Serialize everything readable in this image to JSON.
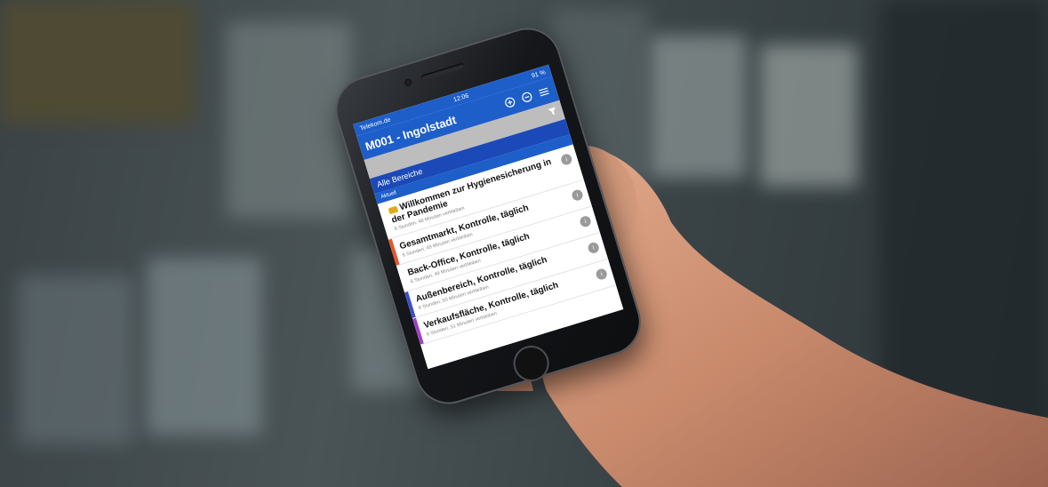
{
  "status_bar": {
    "carrier": "Telekom.de",
    "time": "12:06",
    "battery": "91 %"
  },
  "app_bar": {
    "title": "M001 - Ingolstadt"
  },
  "area_bar": {
    "label": "Alle Bereiche"
  },
  "section": {
    "label": "Aktuell"
  },
  "items": [
    {
      "title": "Willkommen zur Hygienesicherung in der Pandemie",
      "subtitle": "6 Stunden, 48 Minuten verbleiben",
      "badge": "i",
      "accent": ""
    },
    {
      "title": "Gesamtmarkt, Kontrolle, täglich",
      "subtitle": "6 Stunden, 49 Minuten verbleiben",
      "badge": "i",
      "accent": "#e8542a"
    },
    {
      "title": "Back-Office, Kontrolle, täglich",
      "subtitle": "6 Stunden, 49 Minuten verbleiben",
      "badge": "i",
      "accent": "#ffffff"
    },
    {
      "title": "Außenbereich, Kontrolle, täglich",
      "subtitle": "6 Stunden, 50 Minuten verbleiben",
      "badge": "i",
      "accent": "#3a4fc9"
    },
    {
      "title": "Verkaufsfläche, Kontrolle, täglich",
      "subtitle": "6 Stunden, 51 Minuten verbleiben",
      "badge": "i",
      "accent": "#a040c8"
    }
  ],
  "icons": {
    "add": "plus-circle-icon",
    "remove": "minus-circle-icon",
    "menu": "hamburger-menu-icon",
    "filter": "filter-icon",
    "welcome_emoji": "construction-helmet-icon",
    "info": "info-icon"
  },
  "colors": {
    "primary": "#1e5ec9",
    "area_bar": "#1c49b8",
    "filter_bar": "#bdbdbd"
  }
}
